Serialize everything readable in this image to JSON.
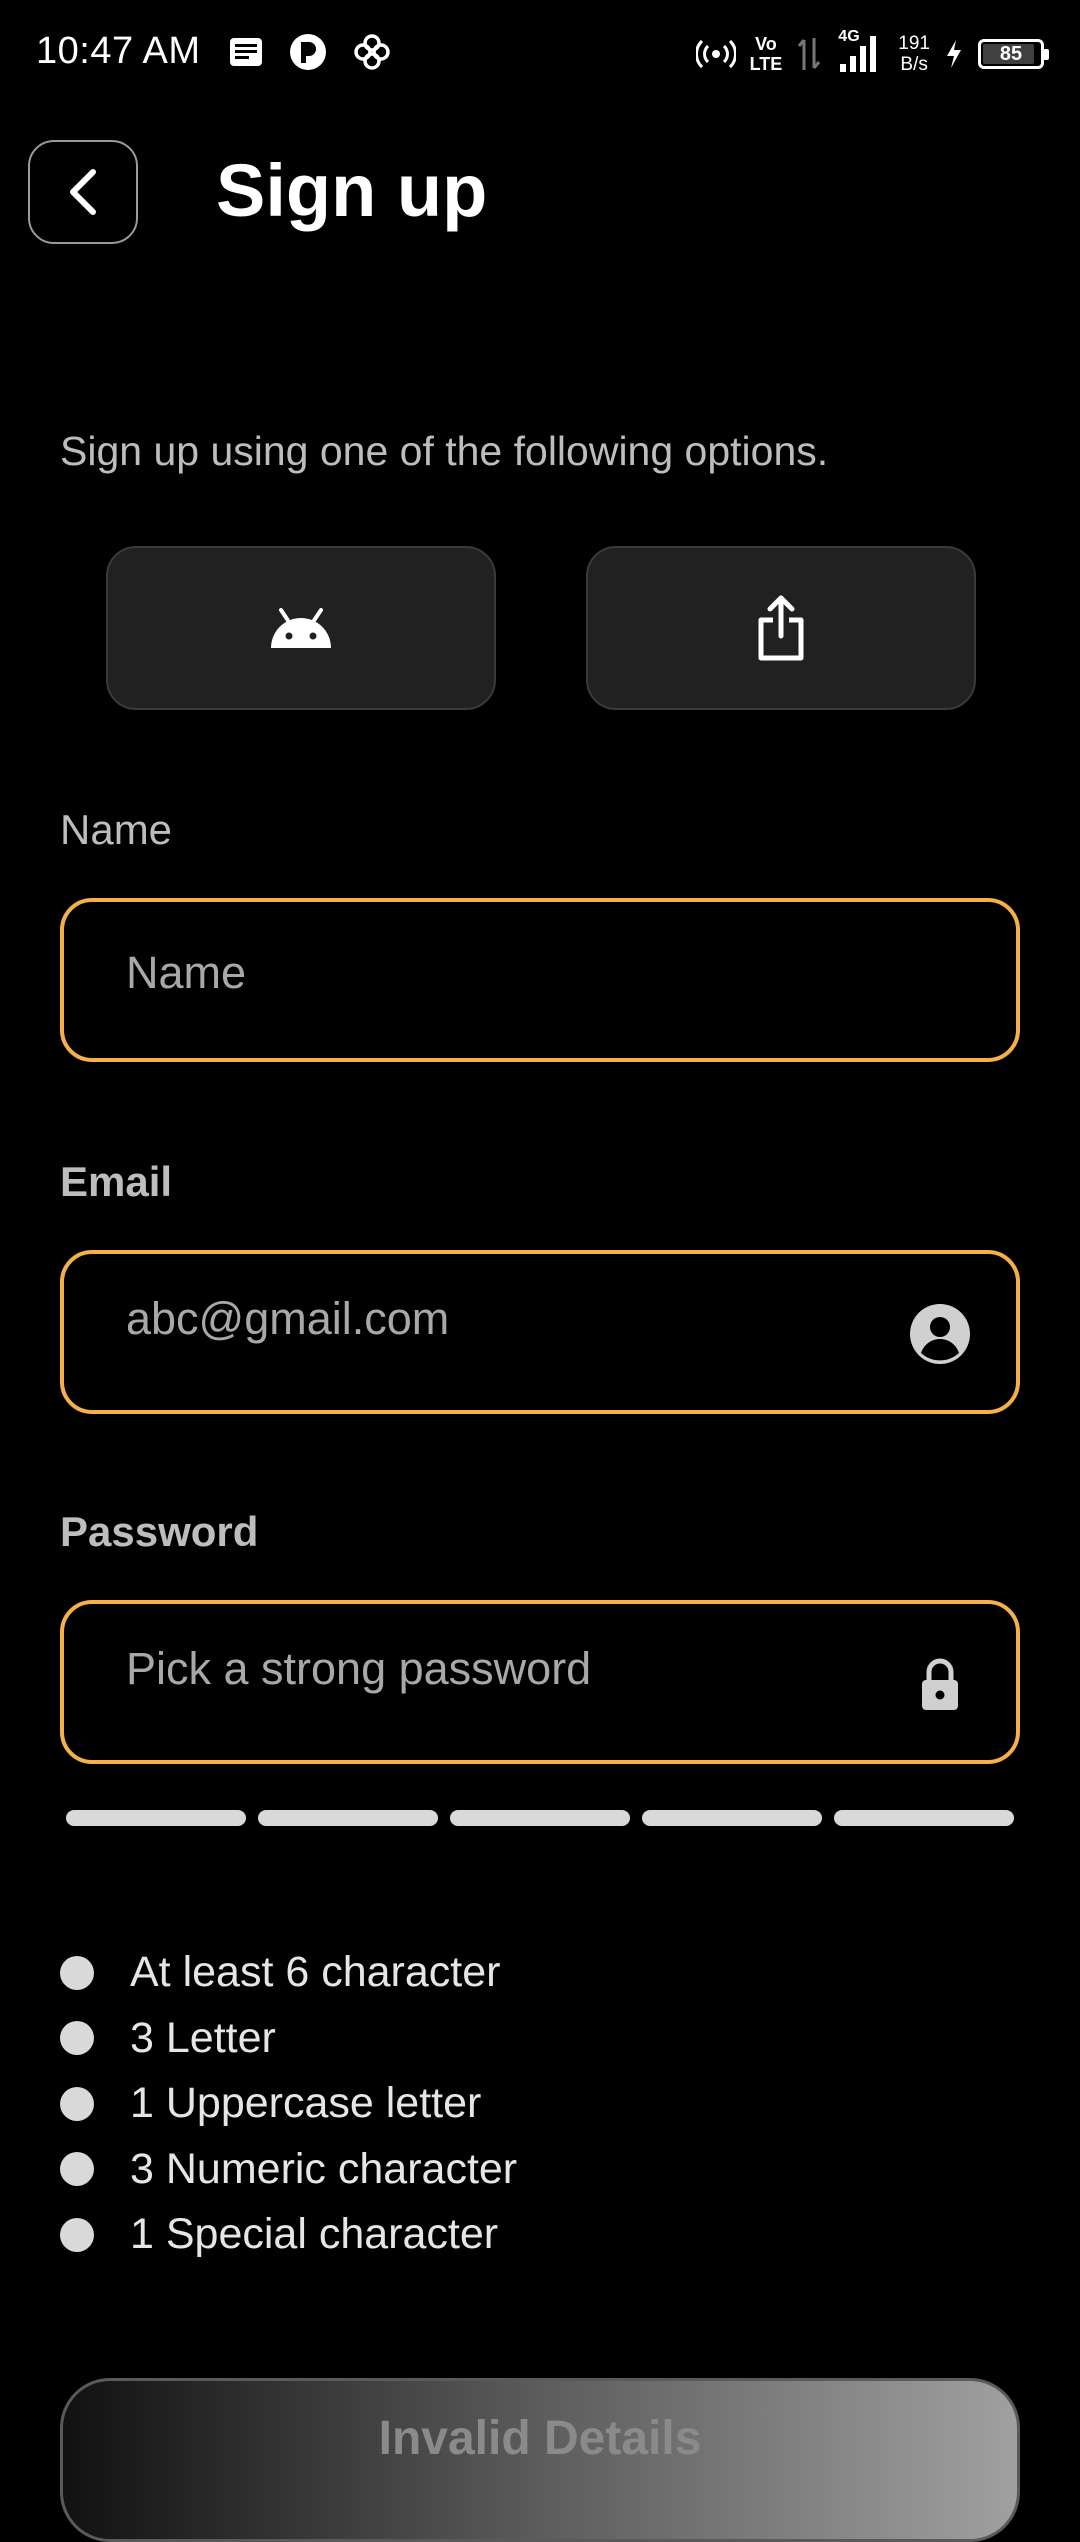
{
  "status_bar": {
    "time": "10:47 AM",
    "network_top": "Vo",
    "network_bottom": "LTE",
    "signal_type": "4G",
    "speed_value": "191",
    "speed_unit": "B/s",
    "battery": "85"
  },
  "header": {
    "title": "Sign up"
  },
  "intro": "Sign up using one of the following options.",
  "social": {
    "buttons": [
      {
        "icon": "android-icon"
      },
      {
        "icon": "share-icon"
      }
    ]
  },
  "form": {
    "name": {
      "label": "Name",
      "placeholder": "Name",
      "value": ""
    },
    "email": {
      "label": "Email",
      "placeholder": "abc@gmail.com",
      "value": "",
      "icon": "user-circle-icon"
    },
    "password": {
      "label": "Password",
      "placeholder": "Pick a strong password",
      "value": "",
      "icon": "lock-icon"
    }
  },
  "password_strength": {
    "segments": 5,
    "filled": 0
  },
  "requirements": [
    "At least 6 character",
    "3 Letter",
    "1 Uppercase letter",
    "3 Numeric character",
    "1 Special character"
  ],
  "submit": {
    "label": "Invalid Details"
  },
  "colors": {
    "background": "#000000",
    "accent_border": "#f5b04c",
    "social_button_bg": "#212121",
    "muted_text": "#bdbdbd"
  }
}
